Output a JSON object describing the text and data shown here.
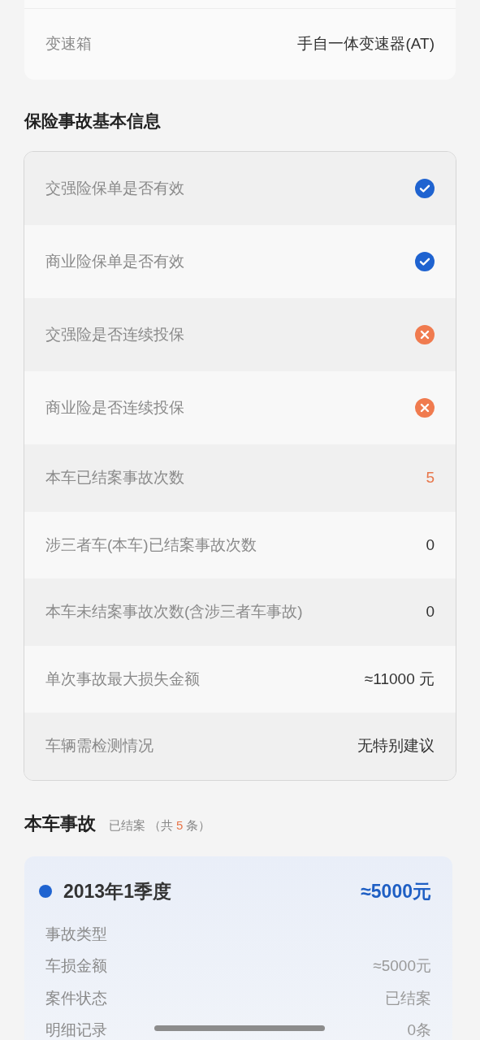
{
  "vehicle_info": {
    "rows": [
      {
        "label": "变速箱",
        "value": "手自一体变速器(AT)"
      }
    ]
  },
  "insurance_section": {
    "title": "保险事故基本信息",
    "rows": [
      {
        "kind": "status",
        "label": "交强险保单是否有效",
        "valid": true
      },
      {
        "kind": "status",
        "label": "商业险保单是否有效",
        "valid": true
      },
      {
        "kind": "status",
        "label": "交强险是否连续投保",
        "valid": false
      },
      {
        "kind": "status",
        "label": "商业险是否连续投保",
        "valid": false
      },
      {
        "kind": "text",
        "label": "本车已结案事故次数",
        "value": "5",
        "highlight": true
      },
      {
        "kind": "text",
        "label": "涉三者车(本车)已结案事故次数",
        "value": "0",
        "highlight": false
      },
      {
        "kind": "text",
        "label": "本车未结案事故次数(含涉三者车事故)",
        "value": "0",
        "highlight": false
      },
      {
        "kind": "text",
        "label": "单次事故最大损失金额",
        "value": "≈11000 元",
        "highlight": false
      },
      {
        "kind": "text",
        "label": "车辆需检测情况",
        "value": "无特别建议",
        "highlight": false
      }
    ]
  },
  "accident_section": {
    "title": "本车事故",
    "status_label": "已结案",
    "count_prefix": "（共",
    "count": "5",
    "count_suffix": "条）",
    "records": [
      {
        "period": "2013年1季度",
        "amount": "≈5000元",
        "details": [
          {
            "label": "事故类型"
          },
          {
            "label": "车损金额",
            "value": "≈5000元"
          },
          {
            "label": "案件状态",
            "value": "已结案"
          },
          {
            "label": "明细记录",
            "value": "0条"
          }
        ]
      }
    ]
  }
}
